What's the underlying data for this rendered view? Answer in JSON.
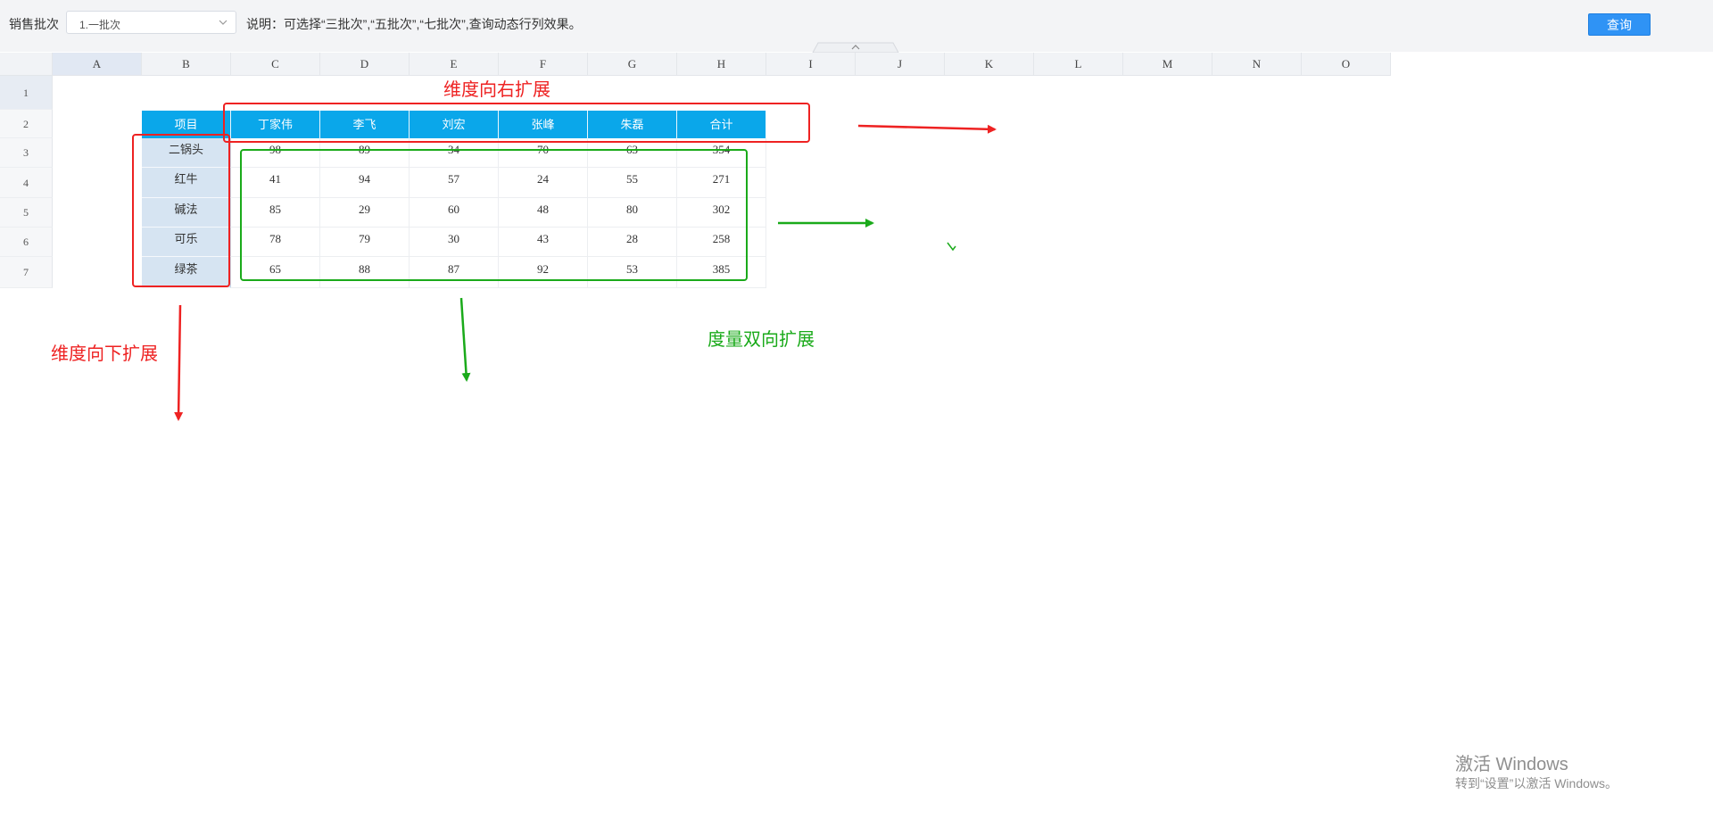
{
  "toolbar": {
    "batch_label": "销售批次",
    "batch_value": "1.一批次",
    "note": "说明：可选择“三批次”,“五批次”,“七批次”,查询动态行列效果。",
    "query_label": "查询"
  },
  "columns": [
    "A",
    "B",
    "C",
    "D",
    "E",
    "F",
    "G",
    "H",
    "I",
    "J",
    "K",
    "L",
    "M",
    "N",
    "O"
  ],
  "rows": [
    "1",
    "2",
    "3",
    "4",
    "5",
    "6",
    "7"
  ],
  "table": {
    "headers": [
      "项目",
      "丁家伟",
      "李飞",
      "刘宏",
      "张峰",
      "朱磊",
      "合计"
    ],
    "data": [
      [
        "二锅头",
        "98",
        "89",
        "34",
        "70",
        "63",
        "354"
      ],
      [
        "红牛",
        "41",
        "94",
        "57",
        "24",
        "55",
        "271"
      ],
      [
        "碱法",
        "85",
        "29",
        "60",
        "48",
        "80",
        "302"
      ],
      [
        "可乐",
        "78",
        "79",
        "30",
        "43",
        "28",
        "258"
      ],
      [
        "绿茶",
        "65",
        "88",
        "87",
        "92",
        "53",
        "385"
      ]
    ]
  },
  "annotations": {
    "right": "维度向右扩展",
    "down": "维度向下扩展",
    "both": "度量双向扩展",
    "red_color": "#ee2222",
    "green_color": "#1aaa1a"
  },
  "watermark": {
    "line1": "激活 Windows",
    "line2": "转到“设置”以激活 Windows。"
  },
  "colors": {
    "header_bg": "#0aa7ea",
    "dim_bg": "#d6e4f2",
    "button_bg": "#2f93f5"
  },
  "icons": {
    "select": "chevron-down-icon",
    "collapse": "chevron-up-icon"
  }
}
